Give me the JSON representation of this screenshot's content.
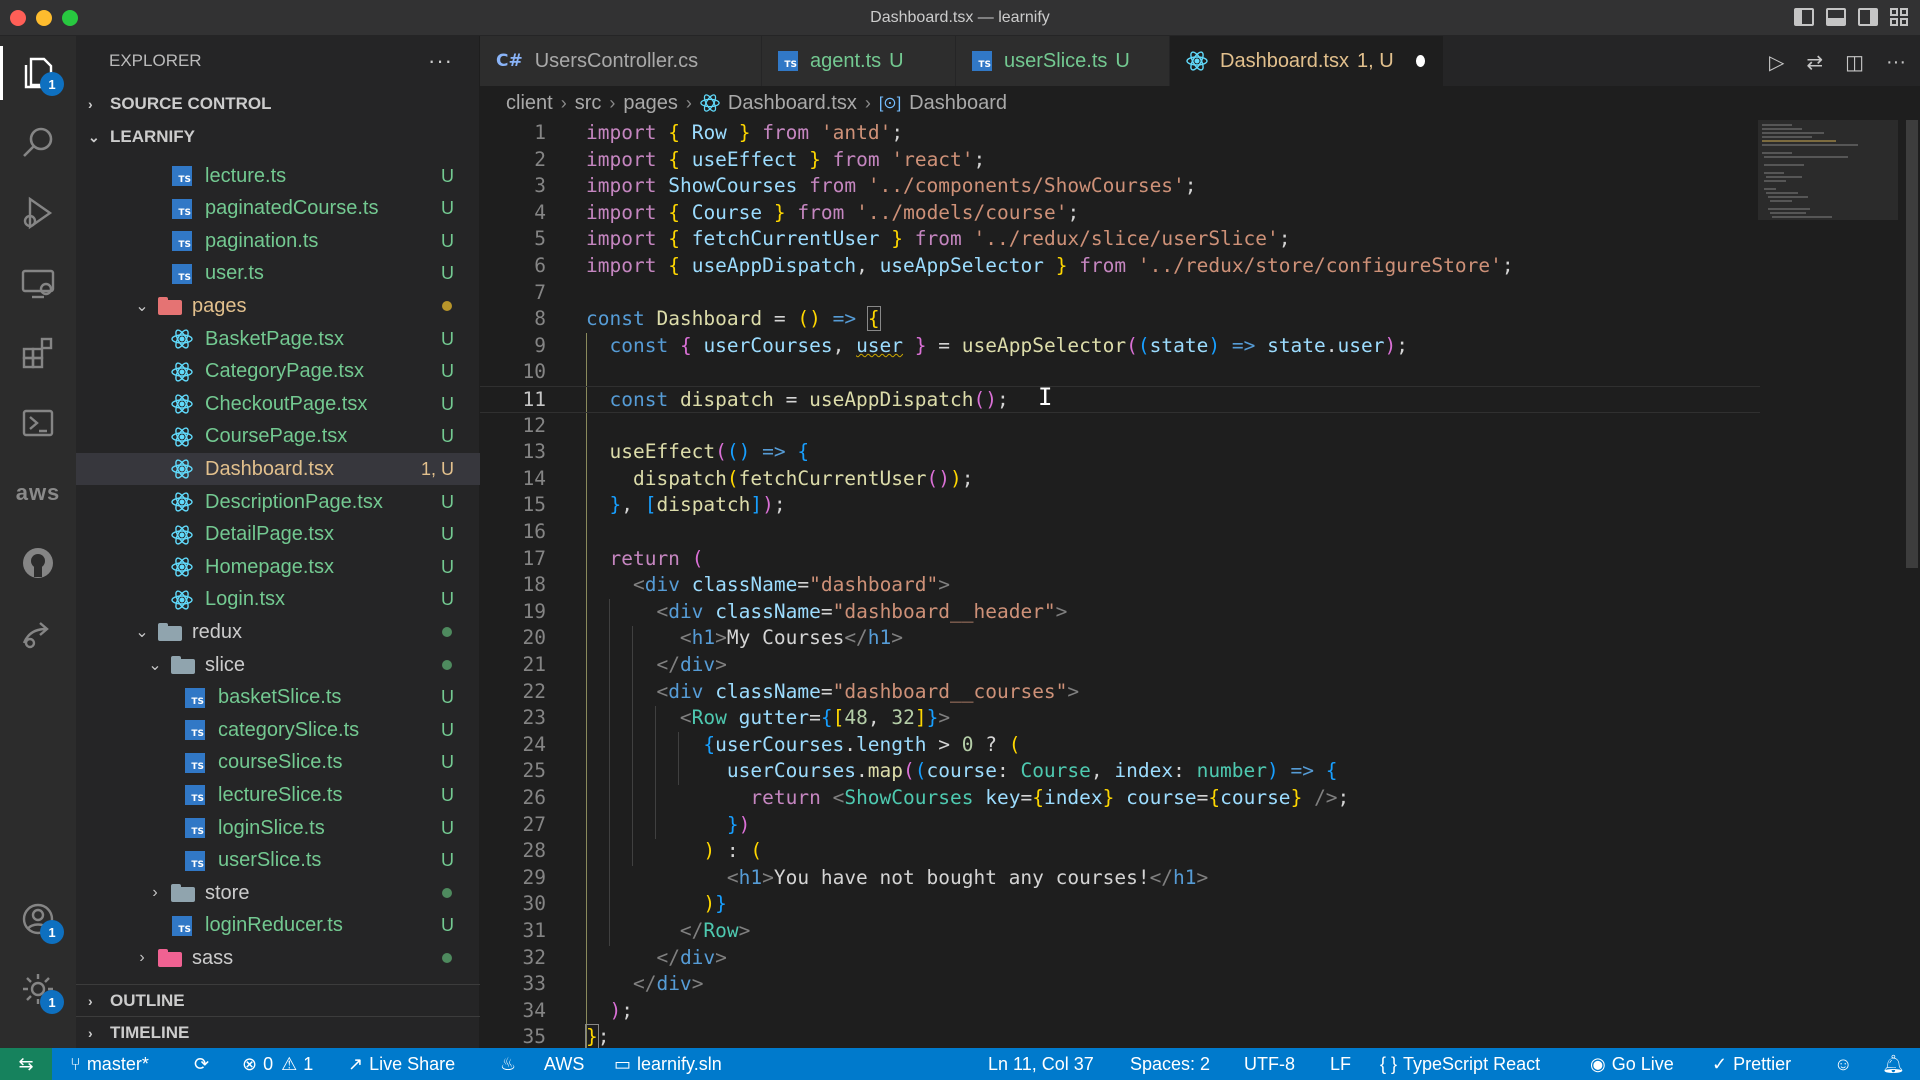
{
  "window": {
    "title": "Dashboard.tsx — learnify"
  },
  "activity": {
    "explorer_badge": "1",
    "aws_label": "aws",
    "accounts_badge": "1",
    "settings_badge": "1"
  },
  "sidebar": {
    "title": "EXPLORER",
    "more": "···",
    "sections": {
      "source_control": "SOURCE CONTROL",
      "project": "LEARNIFY",
      "outline": "OUTLINE",
      "timeline": "TIMELINE"
    },
    "files": [
      {
        "name": "lecture.ts",
        "status": "U"
      },
      {
        "name": "paginatedCourse.ts",
        "status": "U"
      },
      {
        "name": "pagination.ts",
        "status": "U"
      },
      {
        "name": "user.ts",
        "status": "U"
      },
      {
        "name": "pages",
        "status": ""
      },
      {
        "name": "BasketPage.tsx",
        "status": "U"
      },
      {
        "name": "CategoryPage.tsx",
        "status": "U"
      },
      {
        "name": "CheckoutPage.tsx",
        "status": "U"
      },
      {
        "name": "CoursePage.tsx",
        "status": "U"
      },
      {
        "name": "Dashboard.tsx",
        "status": "1, U"
      },
      {
        "name": "DescriptionPage.tsx",
        "status": "U"
      },
      {
        "name": "DetailPage.tsx",
        "status": "U"
      },
      {
        "name": "Homepage.tsx",
        "status": "U"
      },
      {
        "name": "Login.tsx",
        "status": "U"
      },
      {
        "name": "redux",
        "status": ""
      },
      {
        "name": "slice",
        "status": ""
      },
      {
        "name": "basketSlice.ts",
        "status": "U"
      },
      {
        "name": "categorySlice.ts",
        "status": "U"
      },
      {
        "name": "courseSlice.ts",
        "status": "U"
      },
      {
        "name": "lectureSlice.ts",
        "status": "U"
      },
      {
        "name": "loginSlice.ts",
        "status": "U"
      },
      {
        "name": "userSlice.ts",
        "status": "U"
      },
      {
        "name": "store",
        "status": ""
      },
      {
        "name": "loginReducer.ts",
        "status": "U"
      },
      {
        "name": "sass",
        "status": ""
      }
    ]
  },
  "tabs": [
    {
      "label": "UsersController.cs",
      "status": "",
      "icon": "C#"
    },
    {
      "label": "agent.ts",
      "status": "U",
      "icon": "TS"
    },
    {
      "label": "userSlice.ts",
      "status": "U",
      "icon": "TS"
    },
    {
      "label": "Dashboard.tsx",
      "status": "1, U",
      "icon": "react"
    }
  ],
  "breadcrumb": [
    "client",
    "src",
    "pages",
    "Dashboard.tsx",
    "Dashboard"
  ],
  "editor": {
    "line_numbers": [
      "1",
      "2",
      "3",
      "4",
      "5",
      "6",
      "7",
      "8",
      "9",
      "10",
      "11",
      "12",
      "13",
      "14",
      "15",
      "16",
      "17",
      "18",
      "19",
      "20",
      "21",
      "22",
      "23",
      "24",
      "25",
      "26",
      "27",
      "28",
      "29",
      "30",
      "31",
      "32",
      "33",
      "34",
      "35"
    ],
    "current_line": 11
  },
  "statusbar": {
    "branch": "master*",
    "errors": "0",
    "warnings": "1",
    "live_share": "Live Share",
    "aws": "AWS",
    "solution": "learnify.sln",
    "position": "Ln 11, Col 37",
    "spaces": "Spaces: 2",
    "encoding": "UTF-8",
    "eol": "LF",
    "language": "TypeScript React",
    "go_live": "Go Live",
    "prettier": "Prettier"
  },
  "colors": {
    "accent": "#007acc",
    "untracked": "#73c991",
    "modified": "#e2c08d",
    "remote": "#16825d"
  }
}
